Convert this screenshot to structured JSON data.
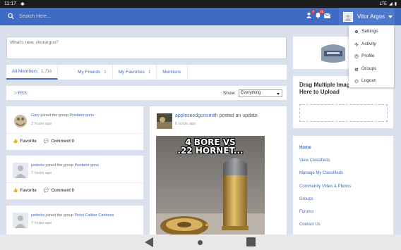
{
  "statusbar": {
    "time": "11:17",
    "network": "LTE"
  },
  "topbar": {
    "search_placeholder": "Search Here...",
    "badges": [
      {
        "icon": "friend-requests-icon",
        "count": "7"
      },
      {
        "icon": "notifications-icon",
        "count": "15"
      },
      {
        "icon": "messages-icon",
        "count": ""
      }
    ],
    "user_name": "Vitor Argos"
  },
  "user_menu": {
    "items": [
      {
        "label": "Settings",
        "icon": "gear-icon"
      },
      {
        "label": "Activity",
        "icon": "activity-icon"
      },
      {
        "label": "Profile",
        "icon": "profile-icon"
      },
      {
        "label": "Groups",
        "icon": "groups-icon"
      },
      {
        "label": "Logout",
        "icon": "power-icon"
      }
    ]
  },
  "status_box": {
    "placeholder": "What's new, vitorargos?"
  },
  "tabs": [
    {
      "label": "All Members",
      "count": "1,714"
    },
    {
      "label": "My Friends",
      "count": "1"
    },
    {
      "label": "My Favorites",
      "count": "1"
    },
    {
      "label": "Mentions",
      "count": ""
    }
  ],
  "filter": {
    "rss_label": "RSS",
    "show_label": "Show:",
    "selected": "Everything"
  },
  "activities": [
    {
      "user": "Gary",
      "action": "joined the group",
      "group": "Predator guns",
      "time": "2 hours ago",
      "favorite": "Favorite",
      "comment": "Comment 0"
    },
    {
      "user": "jonbnks",
      "action": "joined the group",
      "group": "Predator guns",
      "time": "7 hours ago",
      "favorite": "Favorite",
      "comment": "Comment 0"
    },
    {
      "user": "jonbnks",
      "action": "joined the group",
      "group": "Pistol Caliber Carbines",
      "time": "7 hours ago"
    }
  ],
  "post": {
    "user": "appleseedgunsmith",
    "action": "posted an update",
    "time": "6 hours ago",
    "meme_line1": "4 BORE VS",
    "meme_line2": ".22 HORNET..."
  },
  "upload": {
    "title": "Drag Multiple Images or Video Here to Upload"
  },
  "nav": {
    "items": [
      "Home",
      "View Classifieds",
      "Manage My Classifieds",
      "Community Video & Photos",
      "Groups",
      "Forums",
      "Contact Us"
    ]
  }
}
